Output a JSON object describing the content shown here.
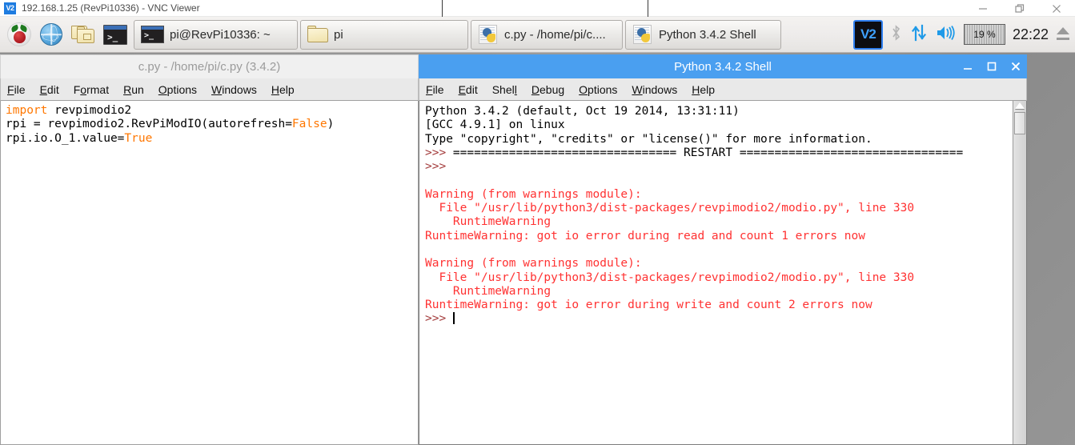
{
  "vnc_window": {
    "title": "192.168.1.25 (RevPi10336) - VNC Viewer",
    "logo_text": "V2",
    "controls": {
      "minimize": "minimize",
      "restore": "restore",
      "close": "close"
    }
  },
  "taskbar": {
    "launchers": [
      {
        "name": "raspberry-menu",
        "label": "Menu"
      },
      {
        "name": "web-browser",
        "label": "Web Browser"
      },
      {
        "name": "file-manager",
        "label": "File Manager"
      },
      {
        "name": "terminal",
        "label": "Terminal"
      }
    ],
    "tasks": [
      {
        "label": "pi@RevPi10336: ~",
        "label_plain": "pi@RevPi10336: ~",
        "icon": "terminal-icon"
      },
      {
        "label": "pi",
        "icon": "folder-icon"
      },
      {
        "label": "c.py - /home/pi/c....",
        "icon": "idle-python-icon"
      },
      {
        "label": "Python 3.4.2 Shell",
        "icon": "idle-python-icon"
      }
    ],
    "tray": {
      "vnc_label": "V2",
      "bluetooth": "✶",
      "cpu_percent": "19",
      "cpu_percent_unit": "%",
      "clock": "22:22"
    }
  },
  "editor_window": {
    "title": "c.py - /home/pi/c.py (3.4.2)",
    "active": false,
    "menus": [
      {
        "label": "File",
        "mnemonic_index": 0
      },
      {
        "label": "Edit",
        "mnemonic_index": 0
      },
      {
        "label": "Format",
        "mnemonic_index": 1
      },
      {
        "label": "Run",
        "mnemonic_index": 0
      },
      {
        "label": "Options",
        "mnemonic_index": 0
      },
      {
        "label": "Windows",
        "mnemonic_index": 0
      },
      {
        "label": "Help",
        "mnemonic_index": 0
      }
    ],
    "code_lines": [
      [
        {
          "t": "import",
          "c": "kw"
        },
        {
          "t": " revpimodio2",
          "c": ""
        }
      ],
      [
        {
          "t": "rpi = revpimodio2.RevPiModIO(autorefresh=",
          "c": ""
        },
        {
          "t": "False",
          "c": "kw"
        },
        {
          "t": ")",
          "c": ""
        }
      ],
      [
        {
          "t": "rpi.io.O_1.value=",
          "c": ""
        },
        {
          "t": "True",
          "c": "kw"
        }
      ]
    ]
  },
  "shell_window": {
    "title": "Python 3.4.2 Shell",
    "active": true,
    "controls": {
      "minimize": "minimize",
      "maximize": "maximize",
      "close": "close"
    },
    "menus": [
      {
        "label": "File",
        "mnemonic_index": 0
      },
      {
        "label": "Edit",
        "mnemonic_index": 0
      },
      {
        "label": "Shell",
        "mnemonic_index": 4
      },
      {
        "label": "Debug",
        "mnemonic_index": 0
      },
      {
        "label": "Options",
        "mnemonic_index": 0
      },
      {
        "label": "Windows",
        "mnemonic_index": 0
      },
      {
        "label": "Help",
        "mnemonic_index": 0
      }
    ],
    "output_lines": [
      [
        {
          "t": "Python 3.4.2 (default, Oct 19 2014, 13:31:11)",
          "c": ""
        }
      ],
      [
        {
          "t": "[GCC 4.9.1] on linux",
          "c": ""
        }
      ],
      [
        {
          "t": "Type \"copyright\", \"credits\" or \"license()\" for more information.",
          "c": ""
        }
      ],
      [
        {
          "t": ">>> ",
          "c": "prompt3"
        },
        {
          "t": "================================ RESTART ================================",
          "c": ""
        }
      ],
      [
        {
          "t": ">>> ",
          "c": "prompt3"
        }
      ],
      [
        {
          "t": "",
          "c": ""
        }
      ],
      [
        {
          "t": "Warning (from warnings module):",
          "c": "errtxt"
        }
      ],
      [
        {
          "t": "  File \"/usr/lib/python3/dist-packages/revpimodio2/modio.py\", line 330",
          "c": "errtxt"
        }
      ],
      [
        {
          "t": "    RuntimeWarning",
          "c": "errtxt"
        }
      ],
      [
        {
          "t": "RuntimeWarning: got io error during read and count 1 errors now",
          "c": "errtxt"
        }
      ],
      [
        {
          "t": "",
          "c": ""
        }
      ],
      [
        {
          "t": "Warning (from warnings module):",
          "c": "errtxt"
        }
      ],
      [
        {
          "t": "  File \"/usr/lib/python3/dist-packages/revpimodio2/modio.py\", line 330",
          "c": "errtxt"
        }
      ],
      [
        {
          "t": "    RuntimeWarning",
          "c": "errtxt"
        }
      ],
      [
        {
          "t": "RuntimeWarning: got io error during write and count 2 errors now",
          "c": "errtxt"
        }
      ],
      [
        {
          "t": ">>> ",
          "c": "prompt3"
        },
        {
          "t": "",
          "c": "cursor"
        }
      ]
    ]
  },
  "colors": {
    "active_title": "#4a9ff0",
    "inactive_title": "#f0f0f0",
    "keyword_orange": "#ff7700",
    "error_red": "#ff3232",
    "prompt_red": "#a33b3b",
    "tray_blue": "#1f9ae8",
    "desktop_grey": "#919191"
  }
}
